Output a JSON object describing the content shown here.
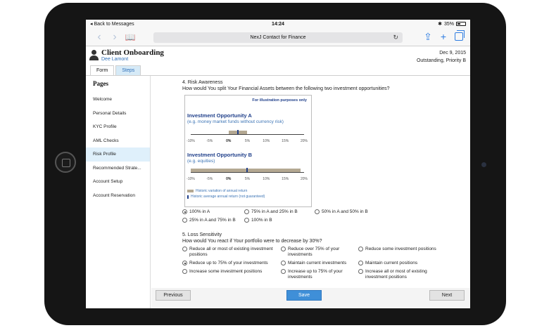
{
  "status_bar": {
    "back": "Back to Messages",
    "time": "14:24",
    "battery": "35%"
  },
  "browser": {
    "url_title": "NexJ Contact for Finance"
  },
  "app": {
    "title": "Client Onboarding",
    "user": "Dee Lamont",
    "date": "Dec 9, 2015",
    "status": "Outstanding, Priority B",
    "tabs": [
      "Form",
      "Steps"
    ]
  },
  "sidebar": {
    "title": "Pages",
    "items": [
      "Welcome",
      "Personal Details",
      "KYC Profile",
      "AML Checks",
      "Risk Profile",
      "Recommended Strate...",
      "Account Setup",
      "Account Reservation"
    ],
    "active_index": 4
  },
  "q4": {
    "title": "4. Risk Awareness",
    "text": "How would You split Your Financial Assets between the following two investment opportunities?",
    "illustration": {
      "note": "For illustration purposes only",
      "a_title": "Investment Opportunity A",
      "a_sub": "(e.g. money market funds without currency risk)",
      "b_title": "Investment Opportunity B",
      "b_sub": "(e.g. equities)",
      "ticks": [
        "-10%",
        "-5%",
        "0%",
        "5%",
        "10%",
        "15%",
        "20%"
      ],
      "legend_variation": "Historic variation of annual return",
      "legend_average": "Historic average annual return (not guaranteed)"
    },
    "options": [
      "100% in A",
      "75% in A and 25% in B",
      "50% in A and 50% in B",
      "25% in A and 75% in B",
      "100% in B"
    ],
    "selected": "100% in A"
  },
  "q5": {
    "title": "5. Loss Sensitivity",
    "text": "How would You react if Your portfolio were to decrease by 30%?",
    "options": [
      "Reduce all or most of existing investment positions",
      "Reduce over 75% of your investments",
      "Reduce some investment positions",
      "Reduce up to 75% of your investments",
      "Maintain current investments",
      "Maintain current positions",
      "Increase some investment positions",
      "Increase up to 75% of your investments",
      "Increase all or most of existing investment positions"
    ],
    "selected": "Reduce up to 75% of your investments"
  },
  "footer": {
    "previous": "Previous",
    "save": "Save",
    "next": "Next"
  }
}
